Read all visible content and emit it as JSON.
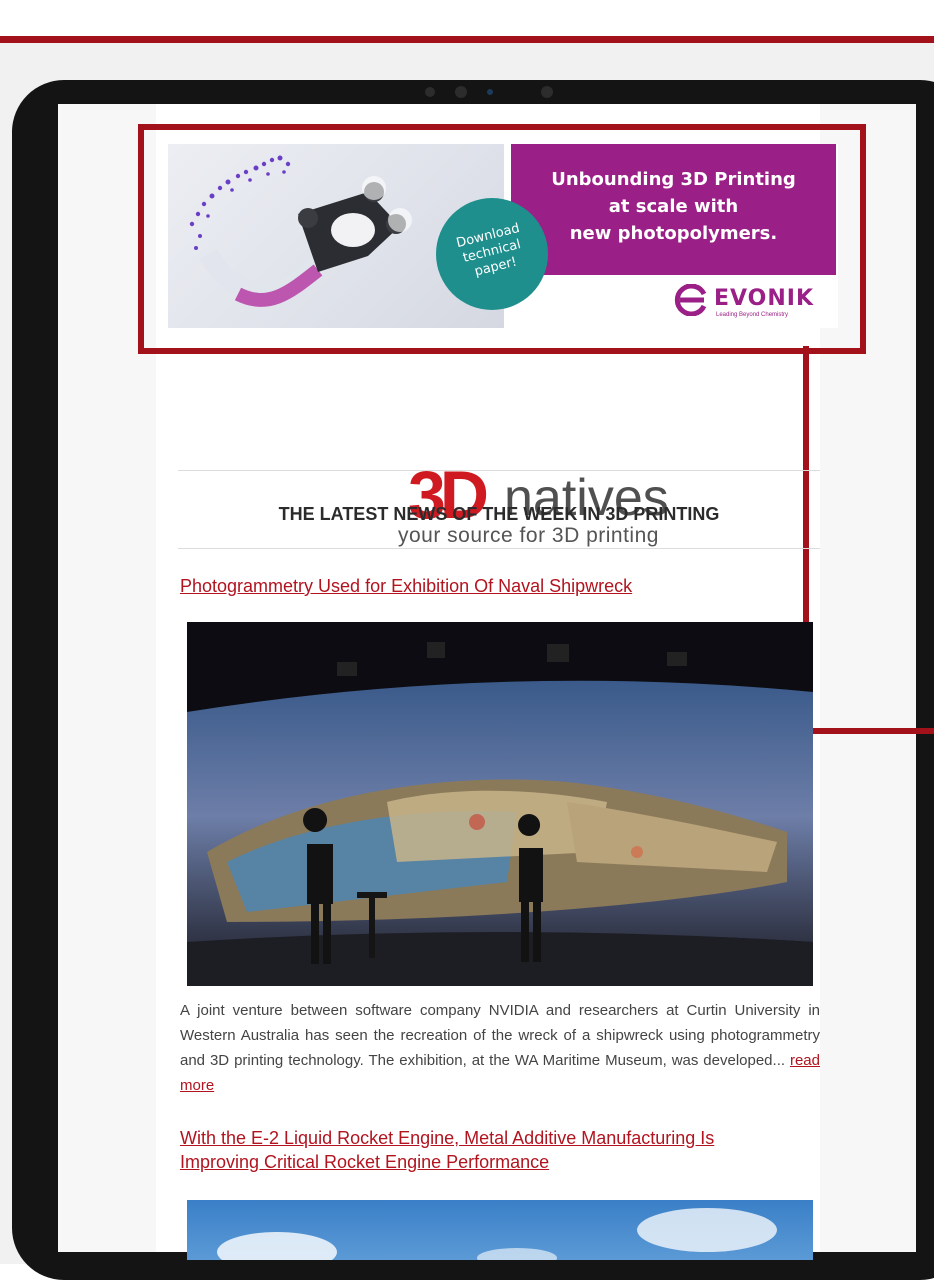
{
  "ad": {
    "headline_lines": [
      "Unbounding 3D Printing",
      "at scale with",
      "new photopolymers."
    ],
    "cta_lines": [
      "Download",
      "technical",
      "paper!"
    ],
    "brand": "EVONIK",
    "brand_tagline": "Leading Beyond Chemistry"
  },
  "logo": {
    "mark": "3D",
    "name": "natives",
    "tagline": "your source for 3D printing"
  },
  "newsletter": {
    "section_title": "THE LATEST NEWS OF THE WEEK IN 3D PRINTING"
  },
  "articles": [
    {
      "title": "Photogrammetry Used for Exhibition Of Naval Shipwreck",
      "summary": "A joint venture between software company NVIDIA and researchers at Curtin University in Western Australia has seen the recreation of the wreck of a shipwreck using photogrammetry and 3D printing technology. The exhibition, at the WA Maritime Museum, was developed...",
      "read_more": "read more"
    },
    {
      "title_lines": [
        "With the E-2 Liquid Rocket Engine, Metal Additive Manufacturing Is",
        "Improving Critical Rocket Engine Performance"
      ]
    }
  ],
  "colors": {
    "accent_red": "#a3121b",
    "link_red": "#b1141f",
    "ad_magenta": "#9a1f86",
    "ad_teal": "#1f8f8e"
  }
}
